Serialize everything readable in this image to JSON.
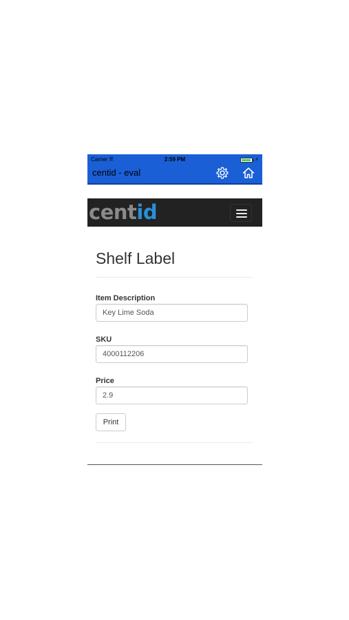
{
  "status_bar": {
    "carrier": "Carrier",
    "time": "2:59 PM",
    "battery_level": 0.85
  },
  "header": {
    "title": "centid - eval",
    "settings_icon": "gear-icon",
    "home_icon": "home-icon",
    "background_color": "#1a5fd6"
  },
  "navbar": {
    "brand_part1": "cent",
    "brand_part2": "id",
    "brand_color1": "#8a8a8a",
    "brand_color2": "#2b8fd8",
    "menu_icon": "hamburger-icon",
    "background_color": "#222222"
  },
  "page": {
    "title": "Shelf Label"
  },
  "form": {
    "item_description": {
      "label": "Item Description",
      "value": "Key Lime Soda"
    },
    "sku": {
      "label": "SKU",
      "value": "4000112206"
    },
    "price": {
      "label": "Price",
      "value": "2.9"
    },
    "print_button": "Print"
  }
}
